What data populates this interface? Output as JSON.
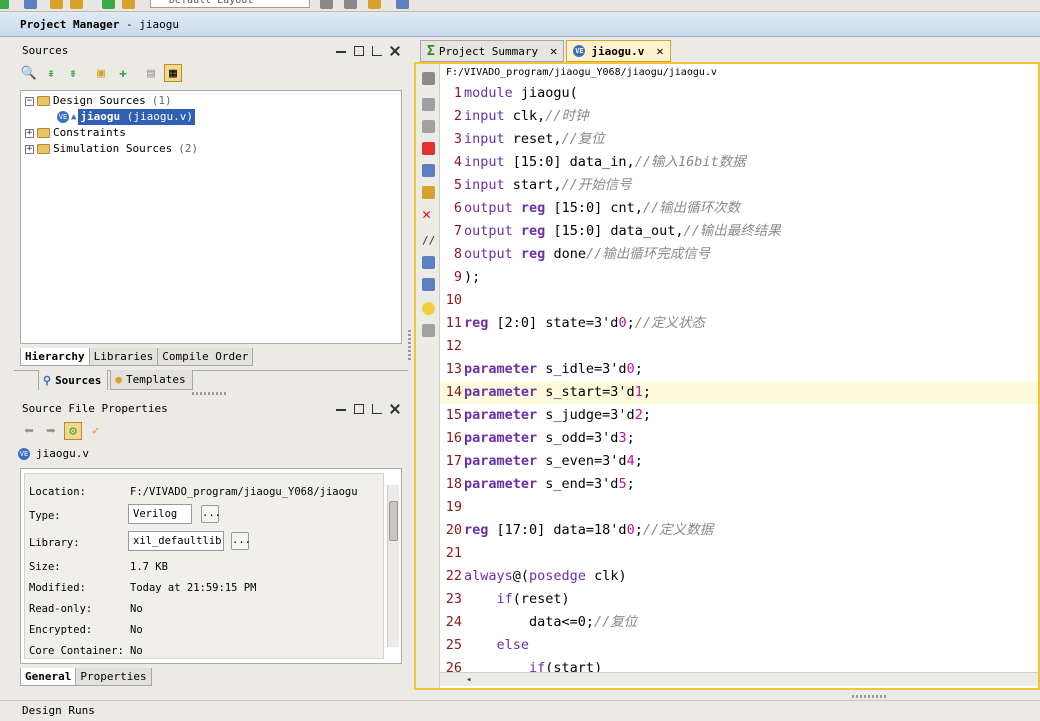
{
  "toolbar": {
    "layout_select": "Default Layout"
  },
  "project_manager": {
    "title": "Project Manager",
    "project": "jiaogu"
  },
  "sources_panel": {
    "title": "Sources",
    "tree": {
      "design_sources": {
        "label": "Design Sources",
        "count": "(1)"
      },
      "top_file": {
        "name": "jiaogu",
        "file": "(jiaogu.v)"
      },
      "constraints": {
        "label": "Constraints"
      },
      "simulation_sources": {
        "label": "Simulation Sources",
        "count": "(2)"
      }
    },
    "view_tabs": [
      "Hierarchy",
      "Libraries",
      "Compile Order"
    ],
    "bottom_tabs": [
      "Sources",
      "Templates"
    ]
  },
  "source_file_properties": {
    "title": "Source File Properties",
    "file_name": "jiaogu.v",
    "properties": [
      {
        "label": "Location:",
        "value": "F:/VIVADO_program/jiaogu_Y068/jiaogu"
      },
      {
        "label": "Type:",
        "value": "Verilog"
      },
      {
        "label": "Library:",
        "value": "xil_defaultlib"
      },
      {
        "label": "Size:",
        "value": "1.7 KB"
      },
      {
        "label": "Modified:",
        "value": "Today at 21:59:15 PM"
      },
      {
        "label": "Read-only:",
        "value": "No"
      },
      {
        "label": "Encrypted:",
        "value": "No"
      },
      {
        "label": "Core Container:",
        "value": "No"
      }
    ],
    "dots": "...",
    "tabs": [
      "General",
      "Properties"
    ]
  },
  "editor": {
    "tabs": [
      {
        "label": "Project Summary",
        "close": "✕"
      },
      {
        "label": "jiaogu.v",
        "close": "✕"
      }
    ],
    "file_path": "F:/VIVADO_program/jiaogu_Y068/jiaogu/jiaogu.v",
    "code_lines": [
      {
        "n": "1",
        "text": "module jiaogu("
      },
      {
        "n": "2",
        "text": "input clk,//时钟"
      },
      {
        "n": "3",
        "text": "input reset,//复位"
      },
      {
        "n": "4",
        "text": "input [15:0] data_in,//输入16bit数据"
      },
      {
        "n": "5",
        "text": "input start,//开始信号"
      },
      {
        "n": "6",
        "text": "output reg [15:0] cnt,//输出循环次数"
      },
      {
        "n": "7",
        "text": "output reg [15:0] data_out,//输出最终结果"
      },
      {
        "n": "8",
        "text": "output reg done//输出循环完成信号"
      },
      {
        "n": "9",
        "text": ");"
      },
      {
        "n": "10",
        "text": ""
      },
      {
        "n": "11",
        "text": "reg [2:0] state=3'd0;//定义状态"
      },
      {
        "n": "12",
        "text": ""
      },
      {
        "n": "13",
        "text": "parameter s_idle=3'd0;"
      },
      {
        "n": "14",
        "text": "parameter s_start=3'd1;"
      },
      {
        "n": "15",
        "text": "parameter s_judge=3'd2;"
      },
      {
        "n": "16",
        "text": "parameter s_odd=3'd3;"
      },
      {
        "n": "17",
        "text": "parameter s_even=3'd4;"
      },
      {
        "n": "18",
        "text": "parameter s_end=3'd5;"
      },
      {
        "n": "19",
        "text": ""
      },
      {
        "n": "20",
        "text": "reg [17:0] data=18'd0;//定义数据"
      },
      {
        "n": "21",
        "text": ""
      },
      {
        "n": "22",
        "text": "always@(posedge clk)"
      },
      {
        "n": "23",
        "text": "    if(reset)"
      },
      {
        "n": "24",
        "text": "        data<=0;//复位"
      },
      {
        "n": "25",
        "text": "    else"
      },
      {
        "n": "26",
        "text": "        if(start)"
      }
    ]
  },
  "design_runs": {
    "title": "Design Runs"
  }
}
